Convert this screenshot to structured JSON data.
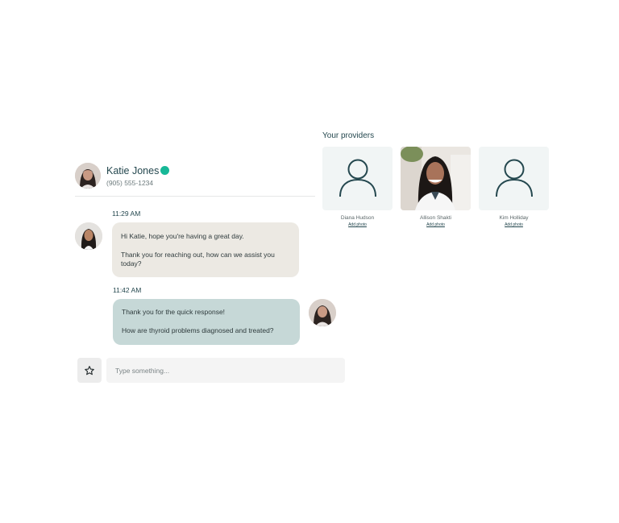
{
  "chat": {
    "contact": {
      "name": "Katie Jones",
      "phone": "(905) 555-1234",
      "status": "online",
      "status_color": "#17b897"
    },
    "messages": [
      {
        "time": "11:29 AM",
        "direction": "incoming",
        "paragraphs": [
          "Hi Katie, hope you're having a great day.",
          "Thank you for reaching out, how can we assist you today?"
        ]
      },
      {
        "time": "11:42 AM",
        "direction": "outgoing",
        "paragraphs": [
          "Thank you for the quick response!",
          "How are thyroid problems diagnosed and treated?"
        ]
      }
    ],
    "composer": {
      "placeholder": "Type something...",
      "favorite_icon": "star-icon"
    }
  },
  "providers": {
    "title": "Your providers",
    "items": [
      {
        "name": "Diana Hudson",
        "action": "Add photo",
        "photo": "person-placeholder-icon"
      },
      {
        "name": "Allison Shakti",
        "action": "Add photo",
        "photo": "provider-portrait"
      },
      {
        "name": "Kim Holliday",
        "action": "Add photo",
        "photo": "person-placeholder-icon"
      }
    ]
  },
  "colors": {
    "accent": "#25484f",
    "incoming_bubble": "#ece9e3",
    "outgoing_bubble": "#c6d8d7",
    "card_bg": "#f1f5f5"
  }
}
